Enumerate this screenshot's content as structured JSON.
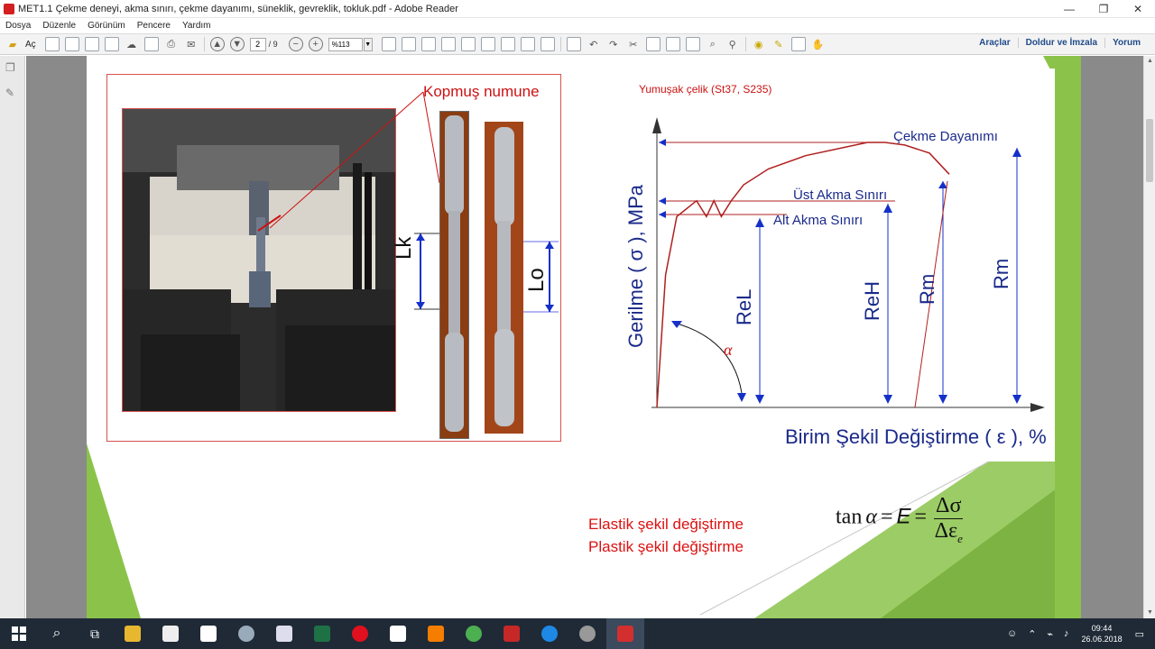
{
  "window": {
    "title": "MET1.1 Çekme deneyi, akma sınırı, çekme dayanımı, süneklik, gevreklik, tokluk.pdf - Adobe Reader",
    "minimize": "—",
    "maximize": "❐",
    "close": "✕"
  },
  "menu": [
    "Dosya",
    "Düzenle",
    "Görünüm",
    "Pencere",
    "Yardım"
  ],
  "toolbar": {
    "open_label": "Aç",
    "page_current": "2",
    "page_total": "/ 9",
    "zoom": "%113",
    "right_links": [
      "Araçlar",
      "Doldur ve İmzala",
      "Yorum"
    ]
  },
  "document": {
    "photo_label": "Kopmuş numune",
    "lk_label": "Lk",
    "lo_label": "Lo",
    "material_label": "Yumuşak çelik (St37, S235)",
    "elastic_label": "Elastik şekil değiştirme",
    "plastic_label": "Plastik şekil değiştirme",
    "formula": {
      "lhs": "tan",
      "alpha": "α",
      "eq1": "=",
      "E": "E",
      "eq2": "=",
      "num": "Δσ",
      "den": "Δε",
      "den_sub": "e"
    }
  },
  "chart_data": {
    "type": "line",
    "title": "",
    "xlabel": "Birim Şekil Değiştirme ( ε ), %",
    "ylabel": "Gerilme ( σ ), MPa",
    "annotations": [
      "Çekme Dayanımı",
      "Üst Akma Sınırı",
      "Alt Akma Sınırı"
    ],
    "symbols": [
      "ReL",
      "ReH",
      "Rm",
      "Rm"
    ],
    "alpha": "α",
    "grid": false,
    "legend": "none",
    "x": [
      0,
      0.35,
      0.8,
      1.6,
      2.0,
      2.3,
      2.6,
      3.0,
      3.5,
      4.5,
      6.0,
      7.5,
      8.5,
      9.2,
      10.0,
      11.0,
      11.8
    ],
    "y": [
      0,
      0.5,
      0.72,
      0.78,
      0.72,
      0.78,
      0.72,
      0.78,
      0.84,
      0.9,
      0.95,
      0.98,
      1.0,
      1.0,
      0.99,
      0.96,
      0.88
    ]
  },
  "taskbar": {
    "time": "09:44",
    "date": "26.06.2018"
  }
}
